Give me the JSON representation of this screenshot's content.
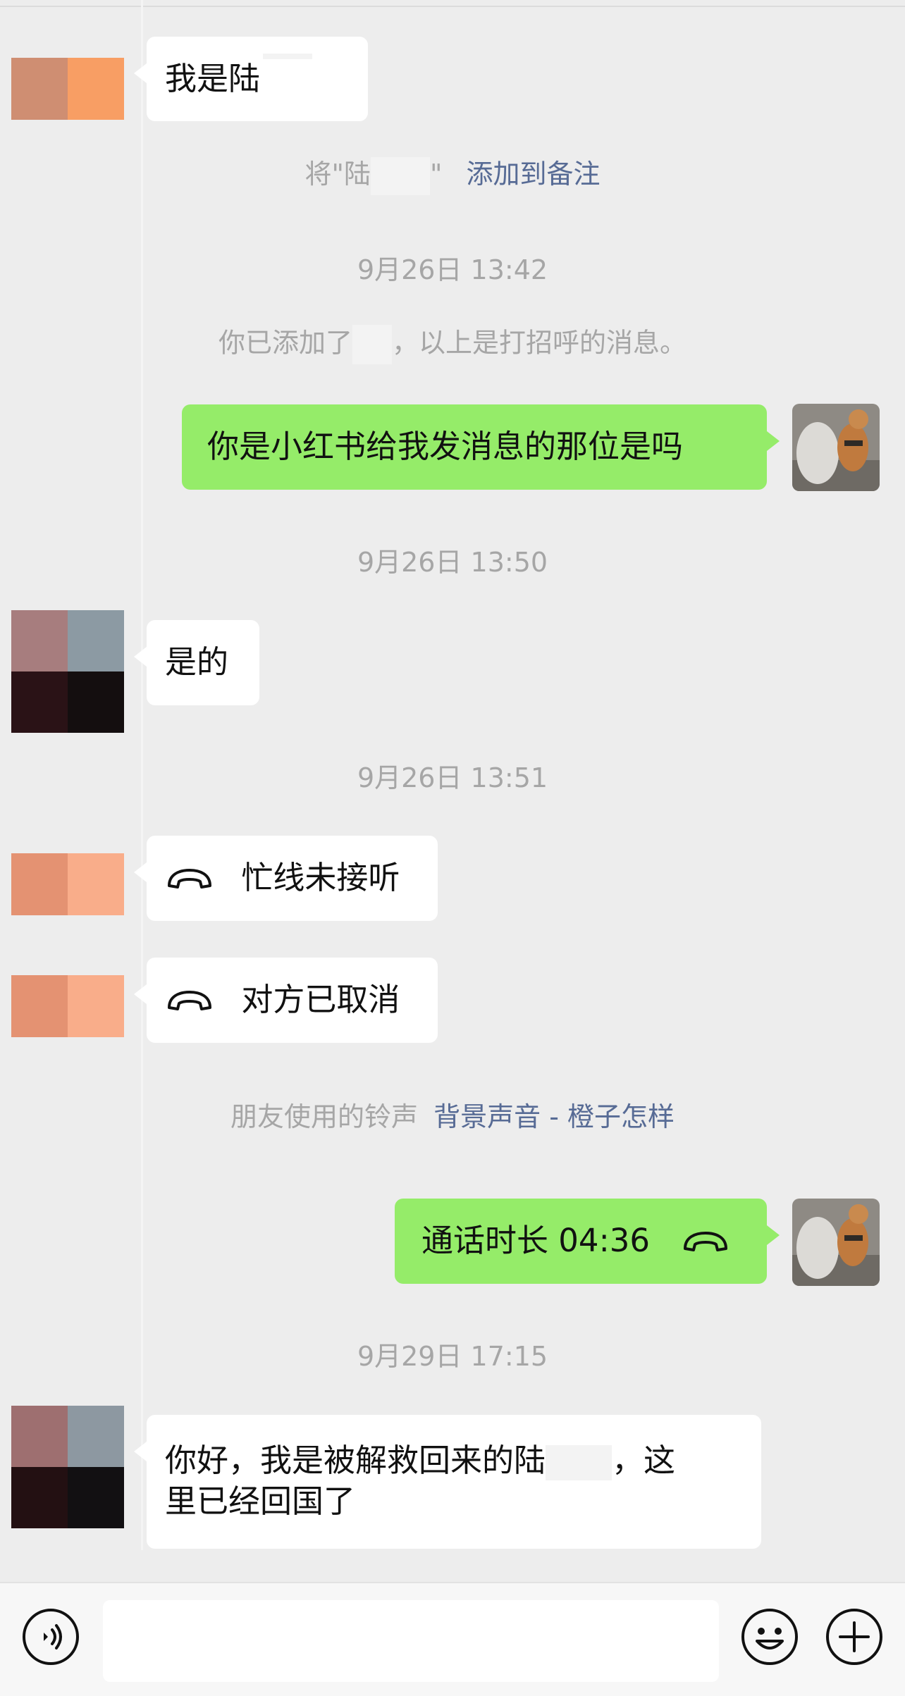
{
  "messages": {
    "m1": "我是陆",
    "m2": "你是小红书给我发消息的那位是吗",
    "m3": "是的",
    "m4": "忙线未接听",
    "m5": "对方已取消",
    "m6": "通话时长 04:36",
    "m7_line1": "你好，我是被解救回来的陆",
    "m7_comma": "，这",
    "m7_line2": "里已经回国了"
  },
  "system": {
    "remark_prefix": "将\"陆",
    "remark_suffix": "\"",
    "remark_link": "添加到备注",
    "time1": "9月26日 13:42",
    "added_prefix": "你已添加了",
    "added_suffix": "，以上是打招呼的消息。",
    "time2": "9月26日 13:50",
    "time3": "9月26日 13:51",
    "ringtone_prefix": "朋友使用的铃声",
    "ringtone_link": "背景声音 - 橙子怎样",
    "time4": "9月29日 17:15"
  },
  "icons": {
    "voice": "voice-input-icon",
    "emoji": "emoji-icon",
    "plus": "plus-icon",
    "phone": "phone-handset-icon"
  },
  "colors": {
    "background": "#ededed",
    "bubble_self": "#95ec69",
    "bubble_other": "#ffffff",
    "link": "#576b95"
  }
}
